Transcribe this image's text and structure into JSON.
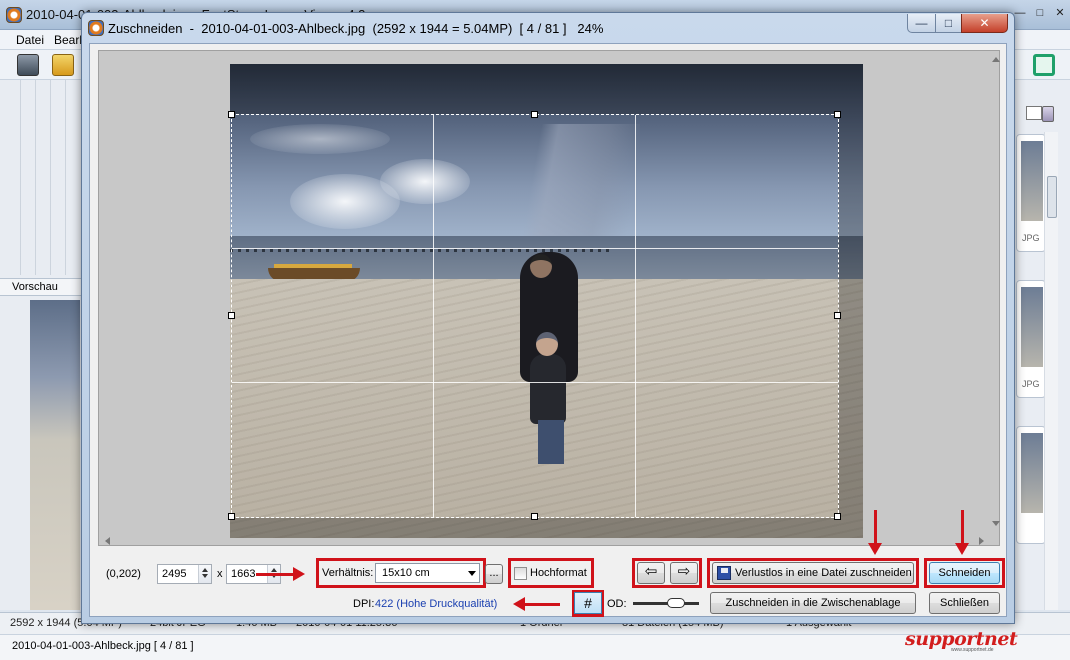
{
  "background_window": {
    "title": "2010-04-01-003-Ahlbeck.jpg - FastStone Image Viewer 4.2",
    "menu": [
      "Datei",
      "Bearbeiten"
    ],
    "left_panel_label": "Vorschau",
    "thumb_badge": "JPG",
    "status_line_1": [
      "2592 x 1944 (5.04 MP)",
      "24bit JPEG",
      "1.46 MB",
      "2010-04-01 11:25:36",
      "1 Ordner",
      "81 Dateien (154 MB)",
      "1 Ausgewählt"
    ],
    "status_line_2": "2010-04-01-003-Ahlbeck.jpg [ 4 / 81 ]"
  },
  "dialog": {
    "title": "Zuschneiden  -  2010-04-01-003-Ahlbeck.jpg  (2592 x 1944 = 5.04MP)  [ 4 / 81 ]   24%",
    "window_buttons": {
      "minimize": "—",
      "maximize": "□",
      "close": "✕"
    }
  },
  "controls": {
    "position": "(0,202)",
    "width": "2495",
    "times": "x",
    "height": "1663",
    "ratio_label": "Verhältnis:",
    "ratio_value": "15x10 cm",
    "ratio_more": "...",
    "portrait_label": "Hochformat",
    "portrait_checked": false,
    "prev_icon": "arrow-left",
    "next_icon": "arrow-right",
    "lossless_button": "Verlustlos in eine Datei zuschneiden",
    "crop_button": "Schneiden",
    "dpi_label": "DPI:",
    "dpi_value": "422 (Hohe Druckqualität)",
    "grid_icon": "#",
    "od_label": "OD:",
    "clipboard_button": "Zuschneiden in die Zwischenablage",
    "close_button": "Schließen"
  },
  "watermark": {
    "brand": "supportnet",
    "url": "www.supportnet.de"
  },
  "colors": {
    "highlight": "#d0121a",
    "dpi_text": "#1a3fb0"
  }
}
